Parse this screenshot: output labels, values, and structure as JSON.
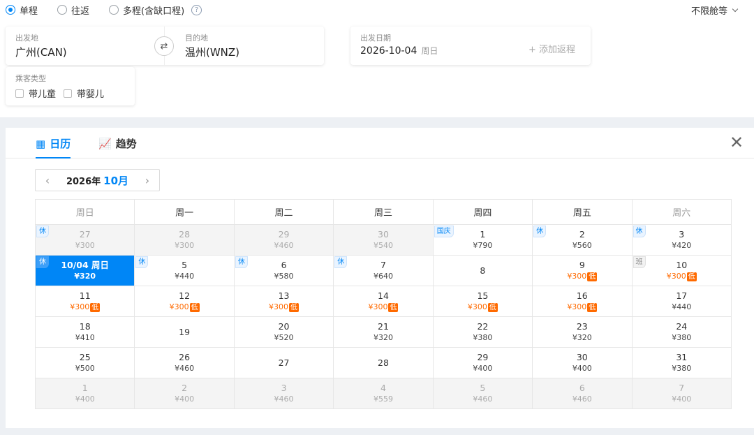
{
  "trip_types": [
    {
      "label": "单程",
      "checked": true
    },
    {
      "label": "往返",
      "checked": false
    },
    {
      "label": "多程(含缺口程)",
      "checked": false
    }
  ],
  "cabin_class": "不限舱等",
  "route": {
    "from_label": "出发地",
    "from_value": "广州(CAN)",
    "to_label": "目的地",
    "to_value": "温州(WNZ)"
  },
  "date": {
    "label": "出发日期",
    "value": "2026-10-04",
    "weekday": "周日",
    "add_return": "+ 添加返程"
  },
  "passenger": {
    "label": "乘客类型",
    "child": "带儿童",
    "infant": "带婴儿"
  },
  "tabs": [
    {
      "label": "日历",
      "icon": "calendar-icon",
      "active": true
    },
    {
      "label": "趋势",
      "icon": "trend-chart-icon",
      "active": false
    }
  ],
  "month_nav": {
    "year": "2026年",
    "month": "10月"
  },
  "weekdays": [
    "周日",
    "周一",
    "周二",
    "周三",
    "周四",
    "周五",
    "周六"
  ],
  "colors": {
    "accent": "#0086f6",
    "low_price": "#ff6a00"
  },
  "weeks": [
    [
      {
        "day": "27",
        "price": "¥300",
        "badge": "休",
        "outside": true
      },
      {
        "day": "28",
        "price": "¥300",
        "outside": true
      },
      {
        "day": "29",
        "price": "¥460",
        "outside": true
      },
      {
        "day": "30",
        "price": "¥540",
        "outside": true
      },
      {
        "day": "1",
        "price": "¥790",
        "badge": "国庆"
      },
      {
        "day": "2",
        "price": "¥560",
        "badge": "休"
      },
      {
        "day": "3",
        "price": "¥420",
        "badge": "休"
      }
    ],
    [
      {
        "day": "10/04 周日",
        "price": "¥320",
        "badge": "休",
        "selected": true
      },
      {
        "day": "5",
        "price": "¥440",
        "badge": "休"
      },
      {
        "day": "6",
        "price": "¥580",
        "badge": "休"
      },
      {
        "day": "7",
        "price": "¥640",
        "badge": "休"
      },
      {
        "day": "8",
        "price": ""
      },
      {
        "day": "9",
        "price": "¥300",
        "low": "低"
      },
      {
        "day": "10",
        "price": "¥300",
        "low": "低",
        "badge": "班",
        "work": true
      }
    ],
    [
      {
        "day": "11",
        "price": "¥300",
        "low": "低"
      },
      {
        "day": "12",
        "price": "¥300",
        "low": "低"
      },
      {
        "day": "13",
        "price": "¥300",
        "low": "低"
      },
      {
        "day": "14",
        "price": "¥300",
        "low": "低"
      },
      {
        "day": "15",
        "price": "¥300",
        "low": "低"
      },
      {
        "day": "16",
        "price": "¥300",
        "low": "低"
      },
      {
        "day": "17",
        "price": "¥440"
      }
    ],
    [
      {
        "day": "18",
        "price": "¥410"
      },
      {
        "day": "19",
        "price": ""
      },
      {
        "day": "20",
        "price": "¥520"
      },
      {
        "day": "21",
        "price": "¥320"
      },
      {
        "day": "22",
        "price": "¥380"
      },
      {
        "day": "23",
        "price": "¥320"
      },
      {
        "day": "24",
        "price": "¥380"
      }
    ],
    [
      {
        "day": "25",
        "price": "¥500"
      },
      {
        "day": "26",
        "price": "¥460"
      },
      {
        "day": "27",
        "price": ""
      },
      {
        "day": "28",
        "price": ""
      },
      {
        "day": "29",
        "price": "¥400"
      },
      {
        "day": "30",
        "price": "¥400"
      },
      {
        "day": "31",
        "price": "¥380"
      }
    ],
    [
      {
        "day": "1",
        "price": "¥400",
        "outside": true
      },
      {
        "day": "2",
        "price": "¥400",
        "outside": true
      },
      {
        "day": "3",
        "price": "¥460",
        "outside": true
      },
      {
        "day": "4",
        "price": "¥559",
        "outside": true
      },
      {
        "day": "5",
        "price": "¥460",
        "outside": true
      },
      {
        "day": "6",
        "price": "¥460",
        "outside": true
      },
      {
        "day": "7",
        "price": "¥400",
        "outside": true
      }
    ]
  ]
}
